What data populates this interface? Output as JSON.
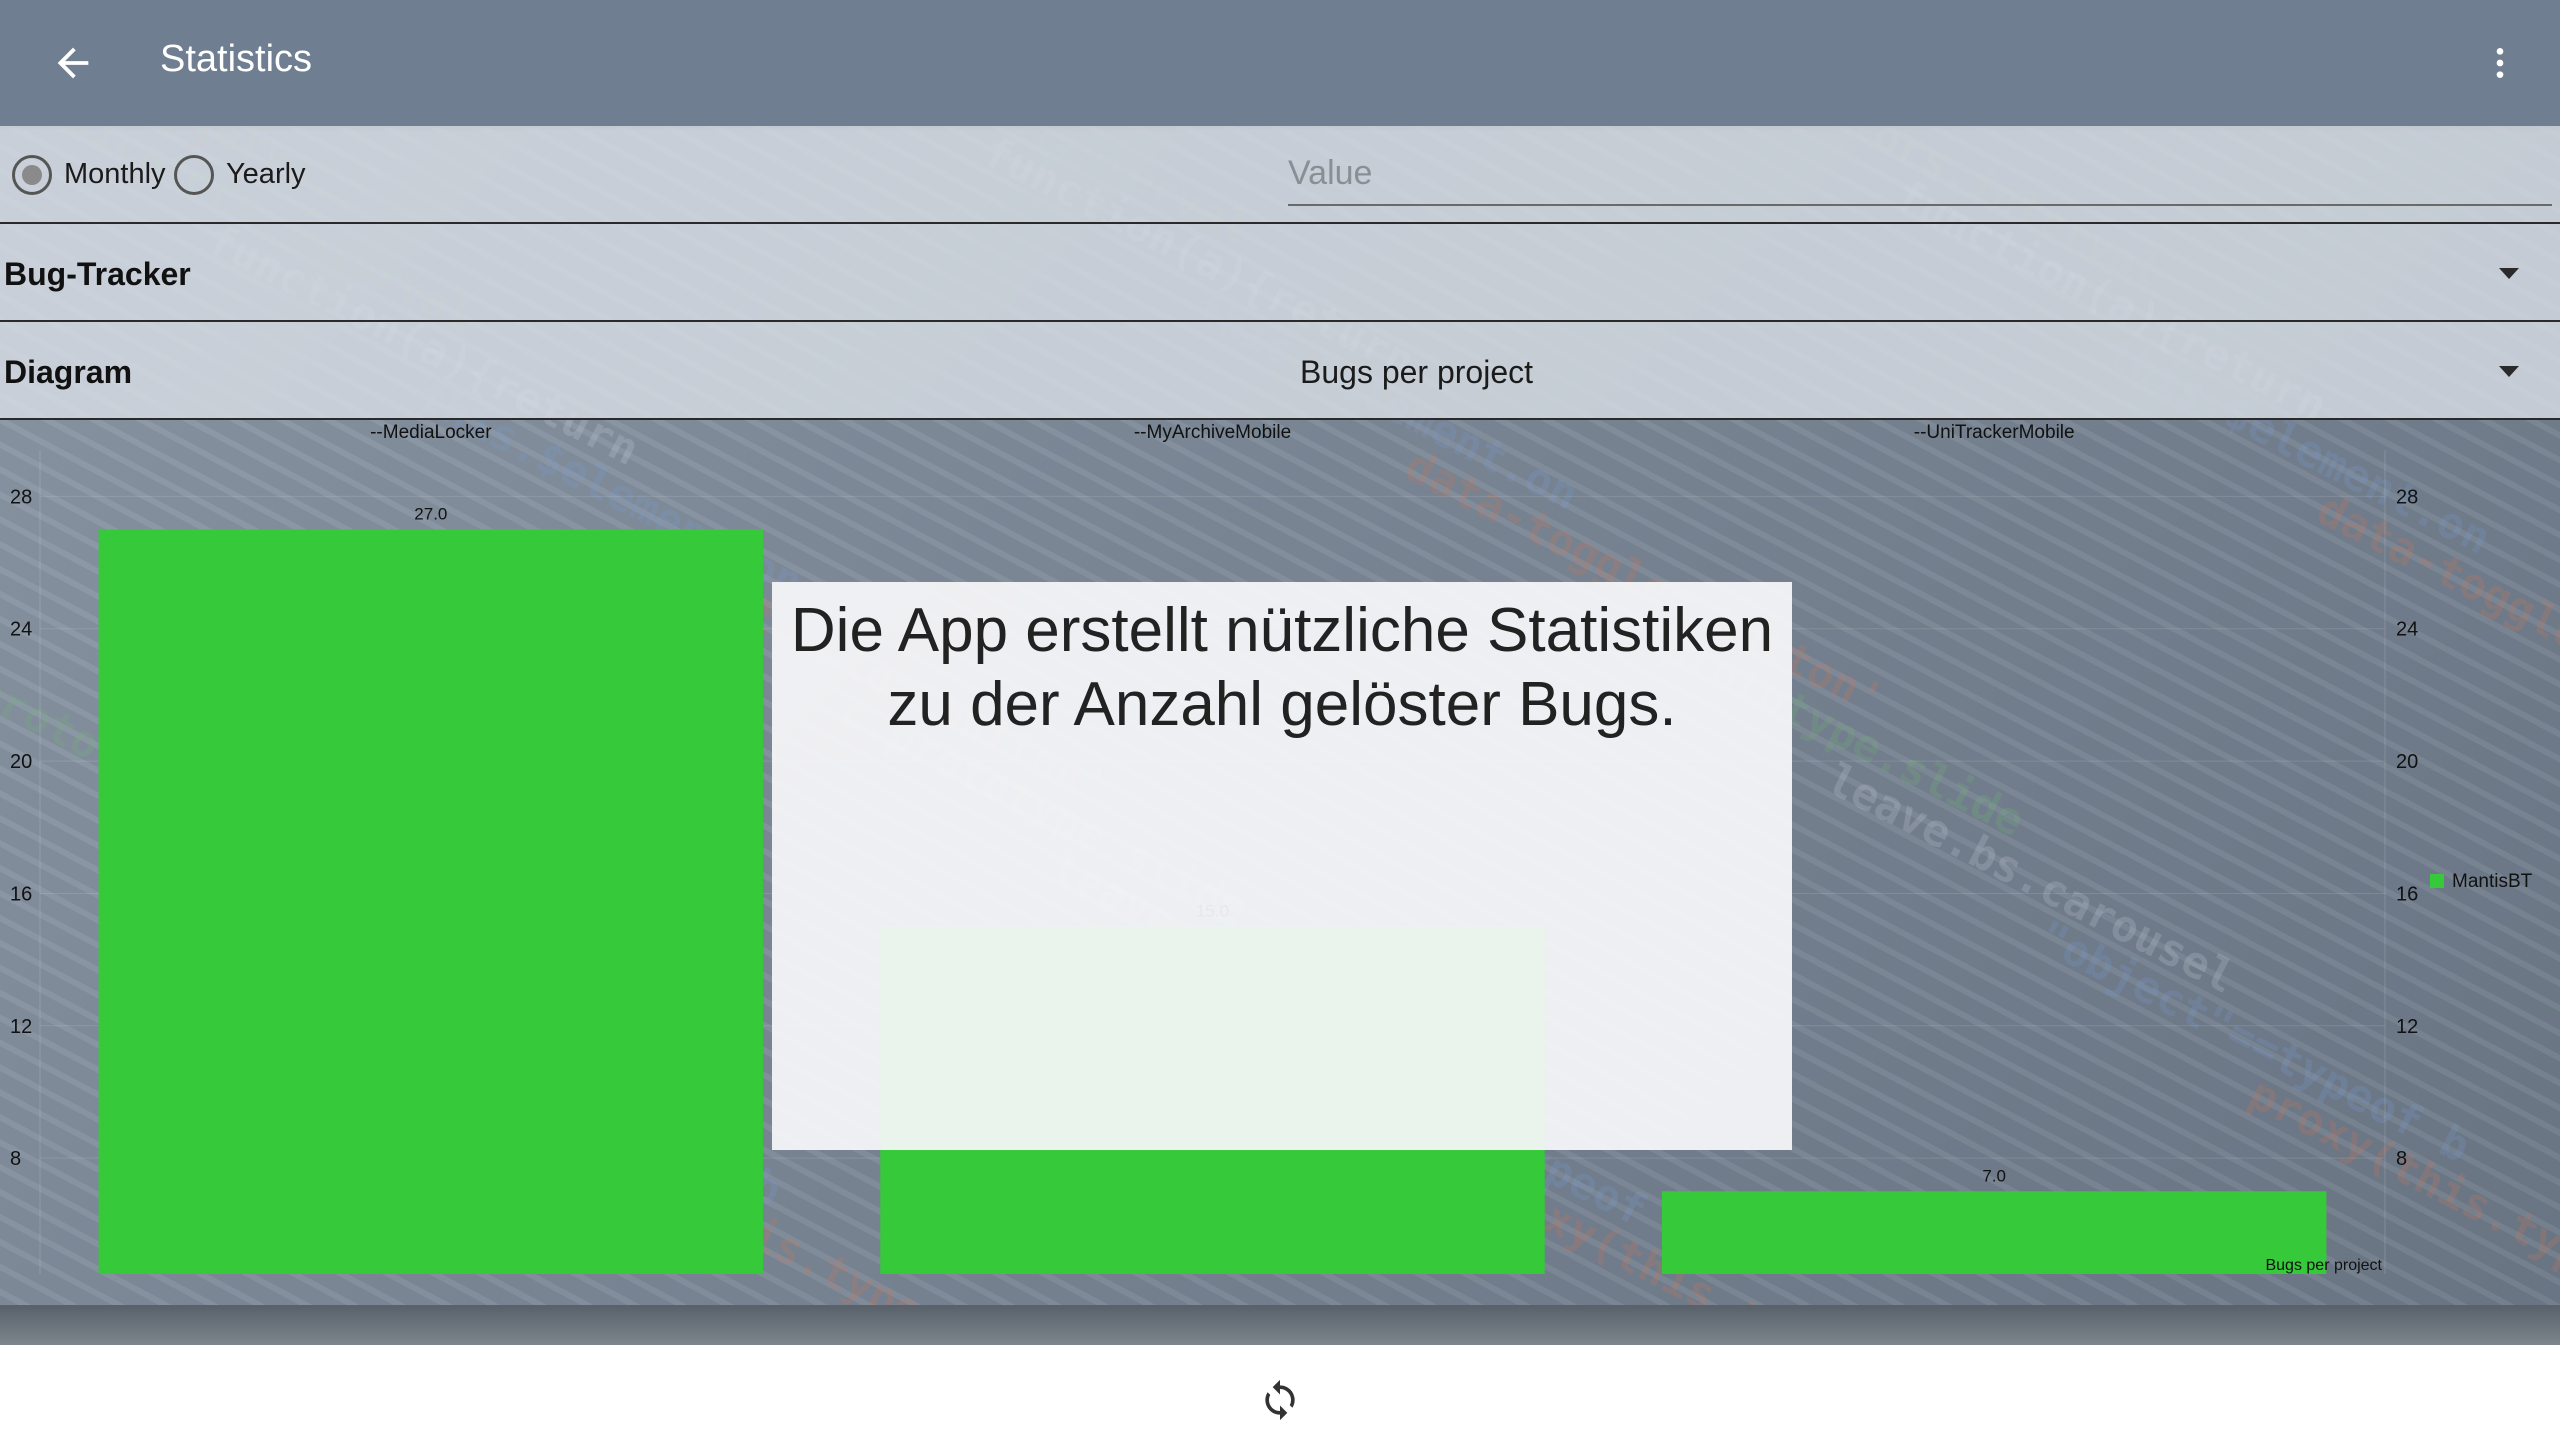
{
  "app_bar": {
    "title": "Statistics",
    "back_icon": "arrow-left-icon",
    "menu_icon": "more-vert-icon"
  },
  "filter": {
    "options": [
      {
        "label": "Monthly",
        "selected": true
      },
      {
        "label": "Yearly",
        "selected": false
      }
    ],
    "value_placeholder": "Value"
  },
  "tracker_spinner": {
    "label": "Bug-Tracker",
    "value": ""
  },
  "diagram_spinner": {
    "label": "Diagram",
    "value": "Bugs per project"
  },
  "overlay": {
    "line1": "Die App erstellt nützliche Statistiken",
    "line2": "zu der Anzahl gelöster Bugs."
  },
  "bottom": {
    "refresh_icon": "refresh-icon"
  },
  "colors": {
    "app_bar": "#6f7f91",
    "bar": "#36c93a",
    "overlay": "#f8f8fa"
  },
  "chart_data": {
    "type": "bar",
    "description": "Bugs per project",
    "categories": [
      "--MediaLocker",
      "--MyArchiveMobile",
      "--UniTrackerMobile"
    ],
    "series": [
      {
        "name": "MantisBT",
        "values": [
          27.0,
          15.0,
          7.0
        ]
      }
    ],
    "value_labels": [
      "27.0",
      "15.0",
      "7.0"
    ],
    "y_ticks": [
      8,
      12,
      16,
      20,
      24,
      28
    ],
    "ylim": [
      4.5,
      29.4
    ],
    "right_axis": true,
    "grid": true,
    "legend_position": "right"
  }
}
